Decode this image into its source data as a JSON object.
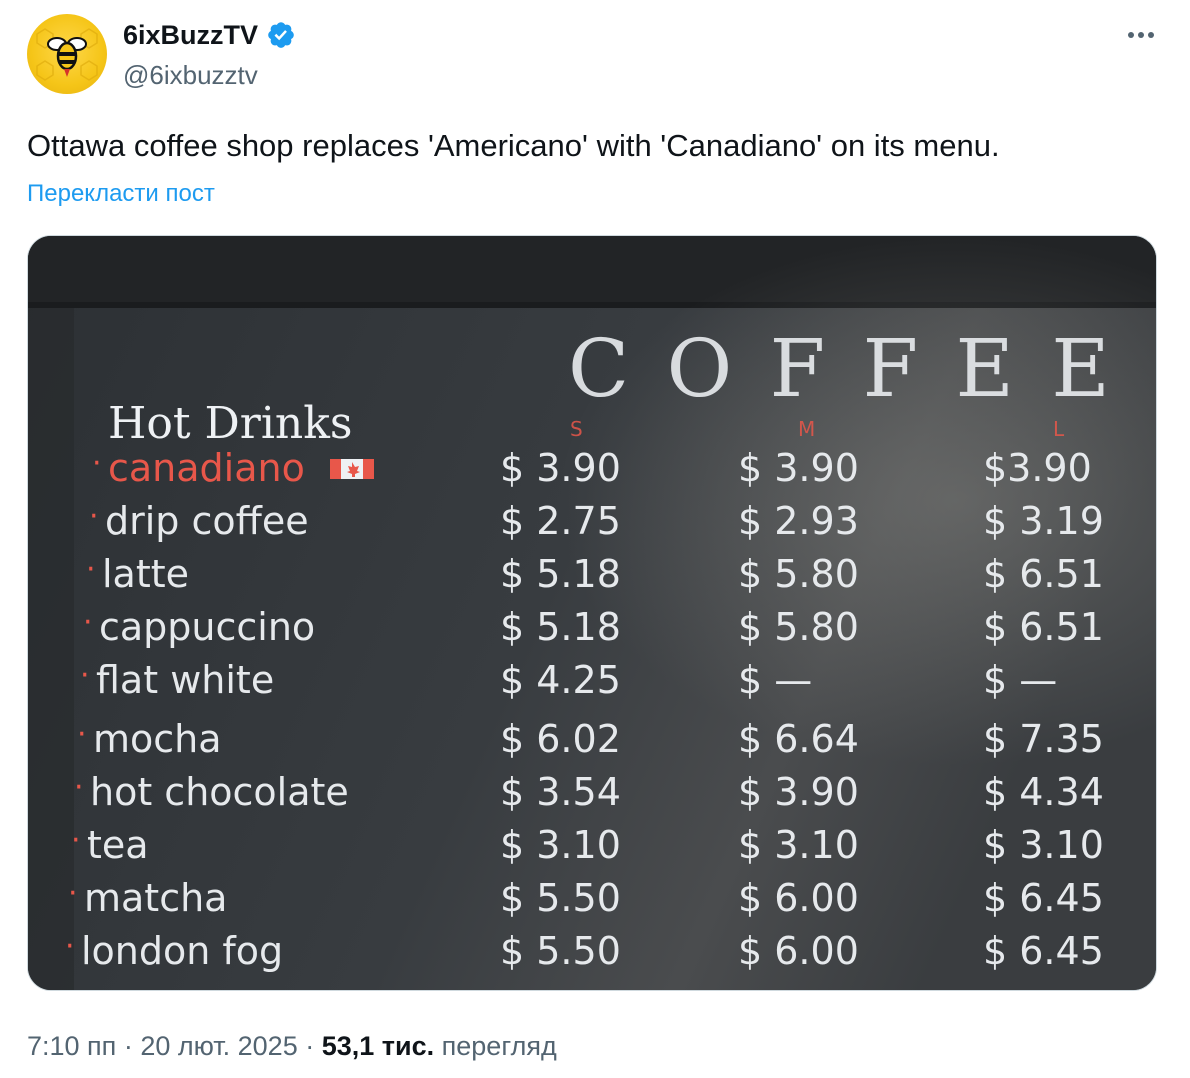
{
  "author": {
    "display_name": "6ixBuzzTV",
    "handle": "@6ixbuzztv",
    "avatar_icon": "bee-logo-icon",
    "verified_icon": "verified-badge-icon",
    "more_icon": "more-icon"
  },
  "post": {
    "text": "Ottawa coffee shop replaces 'Americano' with 'Canadiano' on its menu.",
    "translate_label": "Перекласти пост"
  },
  "menu_image": {
    "heading": "COFFEE",
    "section_title": "Hot Drinks",
    "sizes": [
      "S",
      "M",
      "L"
    ],
    "items": [
      {
        "name": "canadiano",
        "s": "$ 3.90",
        "m": "$ 3.90",
        "l": "$3.90"
      },
      {
        "name": "drip coffee",
        "s": "$ 2.75",
        "m": "$ 2.93",
        "l": "$ 3.19"
      },
      {
        "name": "latte",
        "s": "$ 5.18",
        "m": "$ 5.80",
        "l": "$ 6.51"
      },
      {
        "name": "cappuccino",
        "s": "$ 5.18",
        "m": "$ 5.80",
        "l": "$ 6.51"
      },
      {
        "name": "flat white",
        "s": "$ 4.25",
        "m": "$ —",
        "l": "$ —"
      },
      {
        "name": "mocha",
        "s": "$ 6.02",
        "m": "$ 6.64",
        "l": "$ 7.35"
      },
      {
        "name": "hot chocolate",
        "s": "$ 3.54",
        "m": "$ 3.90",
        "l": "$ 4.34"
      },
      {
        "name": "tea",
        "s": "$ 3.10",
        "m": "$ 3.10",
        "l": "$ 3.10"
      },
      {
        "name": "matcha",
        "s": "$ 5.50",
        "m": "$ 6.00",
        "l": "$ 6.45"
      },
      {
        "name": "london fog",
        "s": "$ 5.50",
        "m": "$ 6.00",
        "l": "$ 6.45"
      }
    ],
    "colors": {
      "chalkboard": "#33373b",
      "chalk": "#e6e9ec",
      "highlight": "#e8574a"
    }
  },
  "meta": {
    "time": "7:10 пп",
    "separator": "·",
    "date": "20 лют. 2025",
    "views_count": "53,1 тис.",
    "views_label": "перегляд"
  }
}
